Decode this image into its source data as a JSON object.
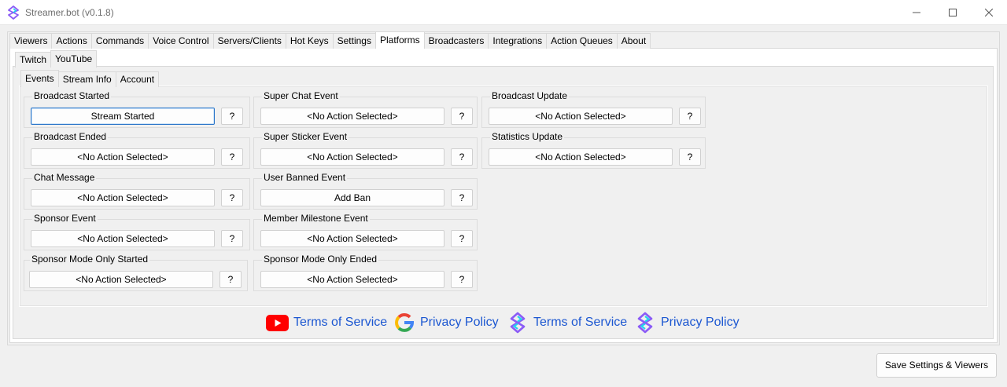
{
  "window": {
    "title": "Streamer.bot (v0.1.8)",
    "controls": [
      "minimize",
      "maximize",
      "close"
    ]
  },
  "main_tabs": [
    {
      "label": "Viewers"
    },
    {
      "label": "Actions"
    },
    {
      "label": "Commands"
    },
    {
      "label": "Voice Control"
    },
    {
      "label": "Servers/Clients"
    },
    {
      "label": "Hot Keys"
    },
    {
      "label": "Settings"
    },
    {
      "label": "Platforms",
      "active": true
    },
    {
      "label": "Broadcasters"
    },
    {
      "label": "Integrations"
    },
    {
      "label": "Action Queues"
    },
    {
      "label": "About"
    }
  ],
  "platform_tabs": [
    {
      "label": "Twitch"
    },
    {
      "label": "YouTube",
      "active": true
    }
  ],
  "youtube_tabs": [
    {
      "label": "Events",
      "active": true
    },
    {
      "label": "Stream Info"
    },
    {
      "label": "Account"
    }
  ],
  "events": [
    {
      "label": "Broadcast Started",
      "action": "Stream Started",
      "help": "?"
    },
    {
      "label": "Broadcast Ended",
      "action": "<No Action Selected>",
      "help": "?"
    },
    {
      "label": "Chat Message",
      "action": "<No Action Selected>",
      "help": "?"
    },
    {
      "label": "Sponsor Event",
      "action": "<No Action Selected>",
      "help": "?"
    },
    {
      "label": "Sponsor Mode Only Started",
      "action": "<No Action Selected>",
      "help": "?"
    },
    {
      "label": "Super Chat Event",
      "action": "<No Action Selected>",
      "help": "?"
    },
    {
      "label": "Super Sticker Event",
      "action": "<No Action Selected>",
      "help": "?"
    },
    {
      "label": "User Banned Event",
      "action": "Add Ban",
      "help": "?"
    },
    {
      "label": "Member Milestone Event",
      "action": "<No Action Selected>",
      "help": "?"
    },
    {
      "label": "Sponsor Mode Only Ended",
      "action": "<No Action Selected>",
      "help": "?"
    },
    {
      "label": "Broadcast Update",
      "action": "<No Action Selected>",
      "help": "?"
    },
    {
      "label": "Statistics Update",
      "action": "<No Action Selected>",
      "help": "?"
    }
  ],
  "links": [
    {
      "text": "Terms of Service",
      "icon": "youtube-icon"
    },
    {
      "text": "Privacy Policy",
      "icon": "google-icon"
    },
    {
      "text": "Terms of Service",
      "icon": "streamerbot-icon"
    },
    {
      "text": "Privacy Policy",
      "icon": "streamerbot-icon"
    }
  ],
  "footer": {
    "save_label": "Save Settings & Viewers"
  },
  "colors": {
    "link": "#1c57d1",
    "focus_border": "#2b76c9",
    "youtube_red": "#ff0000",
    "brand_purple": "#8b5cf6",
    "brand_cyan": "#22d3ee"
  }
}
